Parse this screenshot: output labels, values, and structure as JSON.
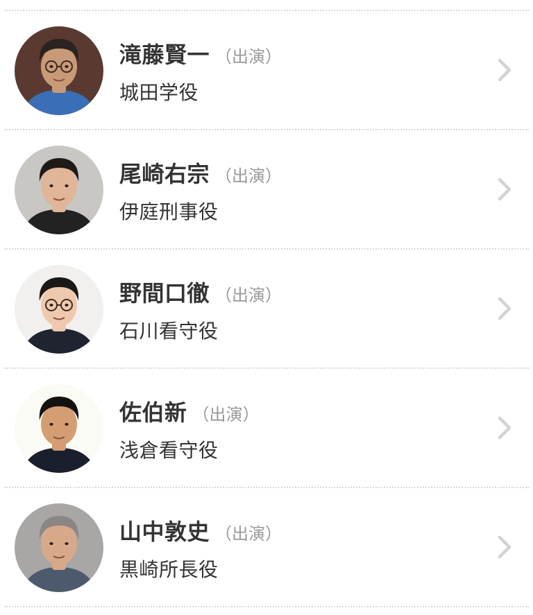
{
  "cast": [
    {
      "name": "滝藤賢一",
      "type": "（出演）",
      "role": "城田学役",
      "skin": "#c99a78",
      "hair": "#2b2320",
      "shirt": "#3a6fb8",
      "bg": "#5a3a30",
      "glasses": true
    },
    {
      "name": "尾崎右宗",
      "type": "（出演）",
      "role": "伊庭刑事役",
      "skin": "#e0b598",
      "hair": "#1e1a18",
      "shirt": "#222222",
      "bg": "#c9c7c4",
      "glasses": false
    },
    {
      "name": "野間口徹",
      "type": "（出演）",
      "role": "石川看守役",
      "skin": "#efc9ae",
      "hair": "#1c1816",
      "shirt": "#1f2430",
      "bg": "#f2f0ee",
      "glasses": true
    },
    {
      "name": "佐伯新",
      "type": "（出演）",
      "role": "浅倉看守役",
      "skin": "#d49e72",
      "hair": "#15110f",
      "shirt": "#1a1f2e",
      "bg": "#fbfbf6",
      "glasses": false
    },
    {
      "name": "山中敦史",
      "type": "（出演）",
      "role": "黒崎所長役",
      "skin": "#d8a989",
      "hair": "#8a8683",
      "shirt": "#4d5a6e",
      "bg": "#a9a7a5",
      "glasses": false
    }
  ]
}
